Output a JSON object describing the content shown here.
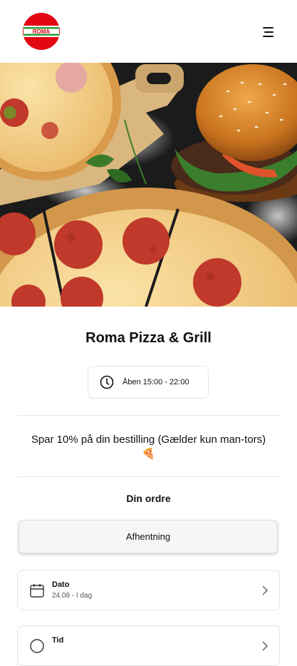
{
  "header": {
    "logo_text": "ROMA",
    "logo_icon": "roma-logo",
    "menu_icon": "hamburger-menu-icon"
  },
  "hero": {
    "image_subject": "pizza-and-burger-photo"
  },
  "restaurant": {
    "name": "Roma Pizza & Grill"
  },
  "hours": {
    "icon": "clock-icon",
    "text": "Åben 15:00 - 22:00"
  },
  "promo": {
    "text": "Spar 10% på din bestilling (Gælder kun man-tors)",
    "emoji": "🍕"
  },
  "order": {
    "label": "Din ordre",
    "mode_button": "Afhentning",
    "date": {
      "label": "Dato",
      "value": "24.08 - I dag",
      "icon": "calendar-icon"
    },
    "time": {
      "label": "Tid",
      "icon": "clock-icon"
    }
  },
  "colors": {
    "brand_red": "#e30613",
    "brand_green": "#2e9e3c",
    "text": "#111111",
    "border": "#e2e2e2"
  }
}
